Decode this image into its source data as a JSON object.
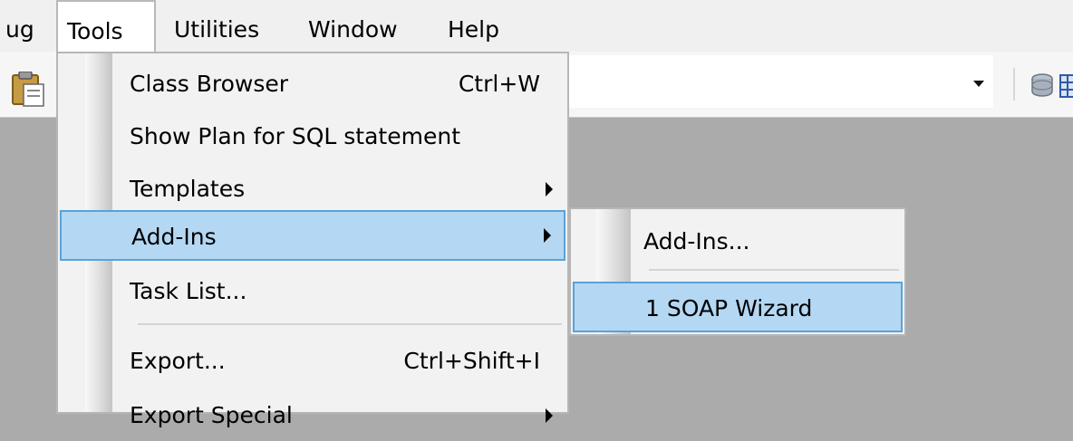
{
  "menubar": {
    "items": [
      {
        "label": "ug"
      },
      {
        "label": "Tools"
      },
      {
        "label": "Utilities"
      },
      {
        "label": "Window"
      },
      {
        "label": "Help"
      }
    ]
  },
  "toolbar": {
    "icons": [
      "paste-icon",
      "dropdown-arrow-icon",
      "database-icon",
      "grid-icon"
    ]
  },
  "tools_menu": {
    "items": [
      {
        "label": "Class Browser",
        "shortcut": "Ctrl+W"
      },
      {
        "label": "Show Plan for SQL statement"
      },
      {
        "label": "Templates",
        "submenu": true
      },
      {
        "label": "Add-Ins",
        "submenu": true,
        "highlighted": true
      },
      {
        "label": "Task List..."
      },
      {
        "label": "Export...",
        "shortcut": "Ctrl+Shift+I"
      },
      {
        "label": "Export Special",
        "submenu": true
      }
    ]
  },
  "addins_submenu": {
    "items": [
      {
        "label": "Add-Ins..."
      },
      {
        "label": "1 SOAP Wizard",
        "highlighted": true
      }
    ]
  },
  "colors": {
    "highlight": "#b4d8f3",
    "highlight_border": "#5aa2d8",
    "menu_bg": "#f2f2f2",
    "workspace_bg": "#ababab"
  }
}
